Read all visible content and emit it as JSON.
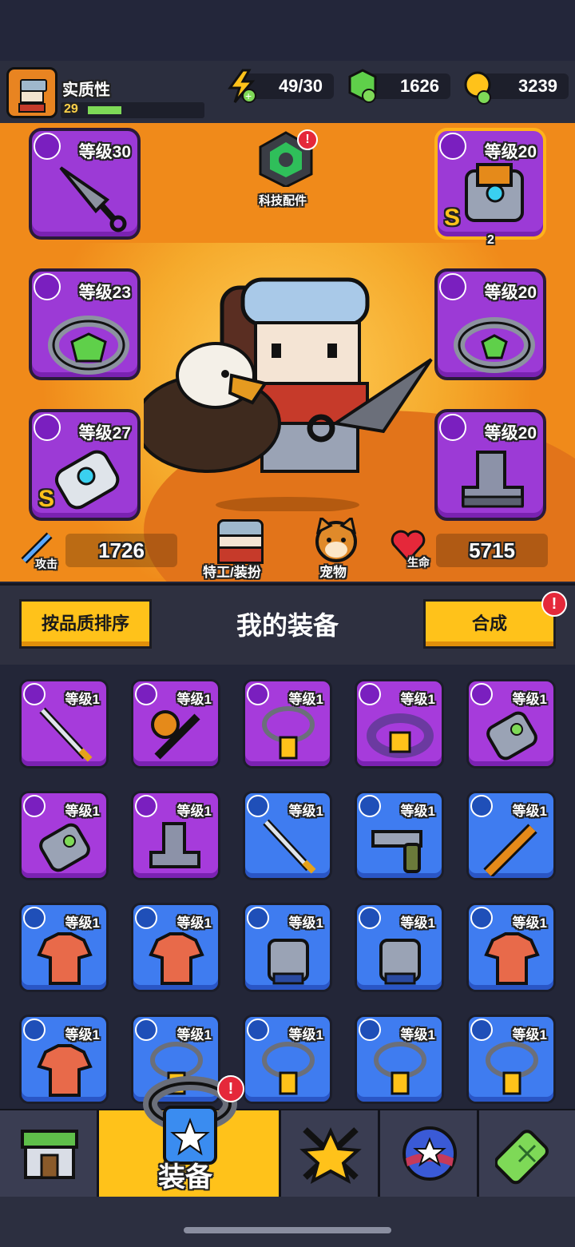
{
  "player": {
    "name": "实质性",
    "level": "29",
    "xp_fraction": 0.3
  },
  "resources": {
    "energy": "49/30",
    "gems": "1626",
    "coins": "3239"
  },
  "tech": {
    "label": "科技配件"
  },
  "slots": [
    {
      "id": "weapon",
      "level": "等级30",
      "icon": "kunai-icon"
    },
    {
      "id": "armor",
      "level": "等级20",
      "icon": "armor-icon",
      "grade": "S",
      "stars": "2"
    },
    {
      "id": "necklace",
      "level": "等级23",
      "icon": "ring-icon"
    },
    {
      "id": "belt",
      "level": "等级20",
      "icon": "belt-icon"
    },
    {
      "id": "glove",
      "level": "等级27",
      "icon": "glove-icon",
      "grade": "S"
    },
    {
      "id": "boots",
      "level": "等级20",
      "icon": "boots-icon"
    }
  ],
  "stats": {
    "attack_label": "攻击",
    "attack": "1726",
    "hp_label": "生命",
    "hp": "5715"
  },
  "hero_buttons": {
    "agent_label": "特工/装扮",
    "pet_label": "宠物"
  },
  "equipment": {
    "sort_label": "按品质排序",
    "title": "我的装备",
    "merge_label": "合成"
  },
  "grid": [
    {
      "level": "等级1",
      "rarity": "purple",
      "icon": "sword-icon"
    },
    {
      "level": "等级1",
      "rarity": "purple",
      "icon": "mace-icon"
    },
    {
      "level": "等级1",
      "rarity": "purple",
      "icon": "necklace-icon"
    },
    {
      "level": "等级1",
      "rarity": "purple",
      "icon": "belt-icon"
    },
    {
      "level": "等级1",
      "rarity": "purple",
      "icon": "glove-icon"
    },
    {
      "level": "等级1",
      "rarity": "purple",
      "icon": "glove-icon"
    },
    {
      "level": "等级1",
      "rarity": "purple",
      "icon": "boots-icon"
    },
    {
      "level": "等级1",
      "rarity": "blue",
      "icon": "sword-icon"
    },
    {
      "level": "等级1",
      "rarity": "blue",
      "icon": "revolver-icon"
    },
    {
      "level": "等级1",
      "rarity": "blue",
      "icon": "bat-icon"
    },
    {
      "level": "等级1",
      "rarity": "blue",
      "icon": "shirt-icon"
    },
    {
      "level": "等级1",
      "rarity": "blue",
      "icon": "shirt-icon"
    },
    {
      "level": "等级1",
      "rarity": "blue",
      "icon": "vest-icon"
    },
    {
      "level": "等级1",
      "rarity": "blue",
      "icon": "vest-icon"
    },
    {
      "level": "等级1",
      "rarity": "blue",
      "icon": "shirt-icon"
    },
    {
      "level": "等级1",
      "rarity": "blue",
      "icon": "shirt-icon"
    },
    {
      "level": "等级1",
      "rarity": "blue",
      "icon": "necklace-icon"
    },
    {
      "level": "等级1",
      "rarity": "blue",
      "icon": "necklace-icon"
    },
    {
      "level": "等级1",
      "rarity": "blue",
      "icon": "necklace-icon"
    },
    {
      "level": "等级1",
      "rarity": "blue",
      "icon": "necklace-icon"
    }
  ],
  "nav": {
    "active_label": "装备",
    "tabs": [
      "shop-icon",
      "equipment-icon",
      "star-icon",
      "orb-icon",
      "dna-icon"
    ]
  }
}
